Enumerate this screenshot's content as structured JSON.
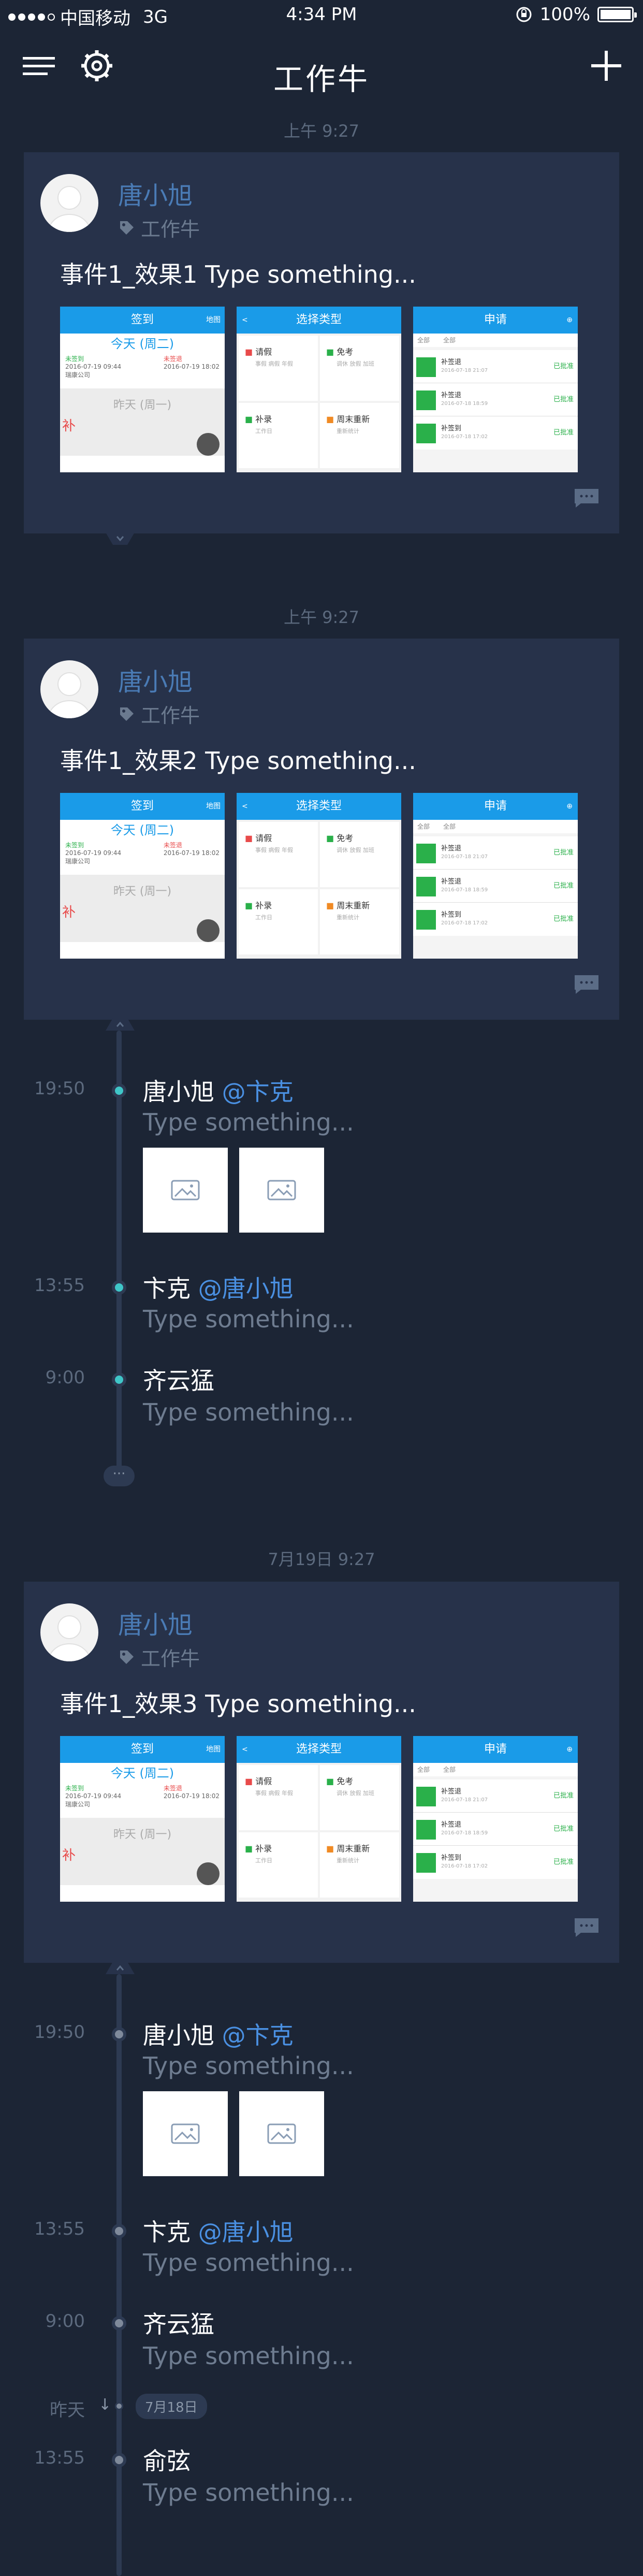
{
  "status_bar": {
    "carrier": "中国移动",
    "network": "3G",
    "time": "4:34 PM",
    "battery": "100%"
  },
  "nav": {
    "title": "工作牛",
    "icons": [
      "menu-icon",
      "settings-icon",
      "add-icon"
    ]
  },
  "separators": [
    "上午 9:27",
    "上午 9:27",
    "7月19日 9:27"
  ],
  "events": [
    {
      "name": "唐小旭",
      "tag": "工作牛",
      "text": "事件1_效果1  Type something..."
    },
    {
      "name": "唐小旭",
      "tag": "工作牛",
      "text": "事件1_效果2  Type something..."
    },
    {
      "name": "唐小旭",
      "tag": "工作牛",
      "text": "事件1_效果3  Type something..."
    }
  ],
  "shots": {
    "checkin": {
      "title": "签到",
      "right": "地图",
      "today": "今天 (周二)",
      "yesterday": "昨天 (周一)",
      "rows": [
        "2016-07-19 09:44",
        "2016-07-19 18:02"
      ],
      "status": [
        "未签到",
        "未签退"
      ],
      "company": "瑞康公司",
      "buke": "补"
    },
    "select_type": {
      "title": "选择类型",
      "items": [
        {
          "label": "请假",
          "sub": "事假 病假 年假"
        },
        {
          "label": "免考",
          "sub": "调休 放假 加班"
        },
        {
          "label": "补录",
          "sub": "工作日"
        },
        {
          "label": "周末重新",
          "sub": "重新统计"
        }
      ]
    },
    "apply": {
      "title": "申请",
      "filters": [
        "全部",
        "全部"
      ],
      "rows": [
        {
          "name": "补签退",
          "date": "2016-07-18 21:07",
          "status": "已批准"
        },
        {
          "name": "补签退",
          "date": "2016-07-18 18:59",
          "status": "已批准"
        },
        {
          "name": "补签到",
          "date": "2016-07-18 17:02",
          "status": "已批准"
        }
      ]
    }
  },
  "timeline1": [
    {
      "time": "19:50",
      "name": "唐小旭",
      "mention": "@卞克",
      "text": "Type something...",
      "images": 2
    },
    {
      "time": "13:55",
      "name": "卞克",
      "mention": "@唐小旭",
      "text": "Type something..."
    },
    {
      "time": "9:00",
      "name": "齐云猛",
      "mention": "",
      "text": "Type something..."
    }
  ],
  "timeline1_more": "···",
  "timeline2": [
    {
      "time": "19:50",
      "name": "唐小旭",
      "mention": "@卞克",
      "text": "Type something...",
      "images": 2
    },
    {
      "time": "13:55",
      "name": "卞克",
      "mention": "@唐小旭",
      "text": "Type something..."
    },
    {
      "time": "9:00",
      "name": "齐云猛",
      "mention": "",
      "text": "Type something..."
    },
    {
      "time": "13:55",
      "name": "俞弦",
      "mention": "",
      "text": "Type something..."
    }
  ],
  "yesterday_marker": {
    "label": "昨天",
    "arrow": "↓",
    "date": "7月18日"
  },
  "colors": {
    "background": "#1c2535",
    "card": "#27324a",
    "accent": "#4a90e2",
    "dot_active": "#3fc6c8",
    "dot_inactive": "#7f8a9b"
  }
}
